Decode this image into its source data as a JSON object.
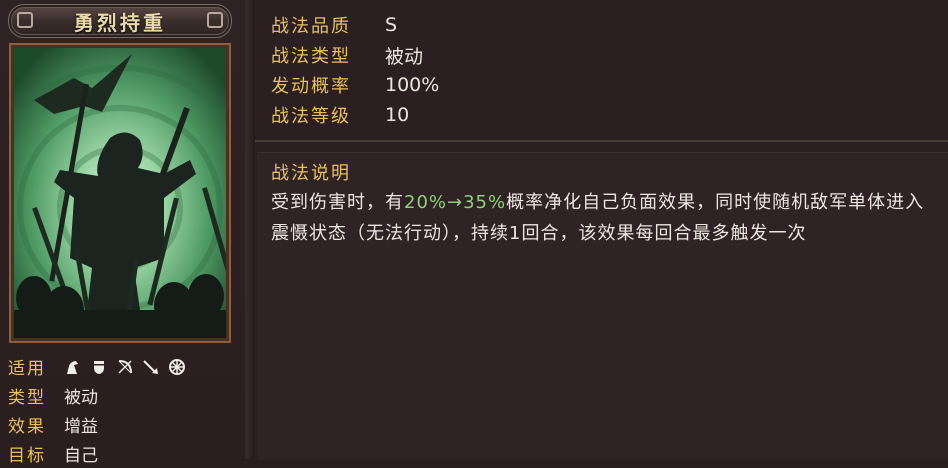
{
  "skill": {
    "name": "勇烈持重"
  },
  "info": [
    {
      "label": "战法品质",
      "value": "S"
    },
    {
      "label": "战法类型",
      "value": "被动"
    },
    {
      "label": "发动概率",
      "value": "100%"
    },
    {
      "label": "战法等级",
      "value": "10"
    }
  ],
  "description": {
    "title": "战法说明",
    "part1": "受到伤害时，有",
    "highlight": "20%→35%",
    "part2": "概率净化自己负面效果，同时使随机敌军单体进入震慑状态（无法行动），持续",
    "num": "1",
    "part3": "回合，该效果每回合最多触发一次"
  },
  "stats": {
    "applicable_label": "适用",
    "applicable_icons": [
      "cavalry-icon",
      "shield-icon",
      "bow-icon",
      "spear-icon",
      "wheel-icon"
    ],
    "type_label": "类型",
    "type_value": "被动",
    "effect_label": "效果",
    "effect_value": "增益",
    "target_label": "目标",
    "target_value": "自己"
  },
  "colors": {
    "gold": "#e8c060",
    "highlight_green": "#8fd07a",
    "text": "#ece6e0"
  }
}
